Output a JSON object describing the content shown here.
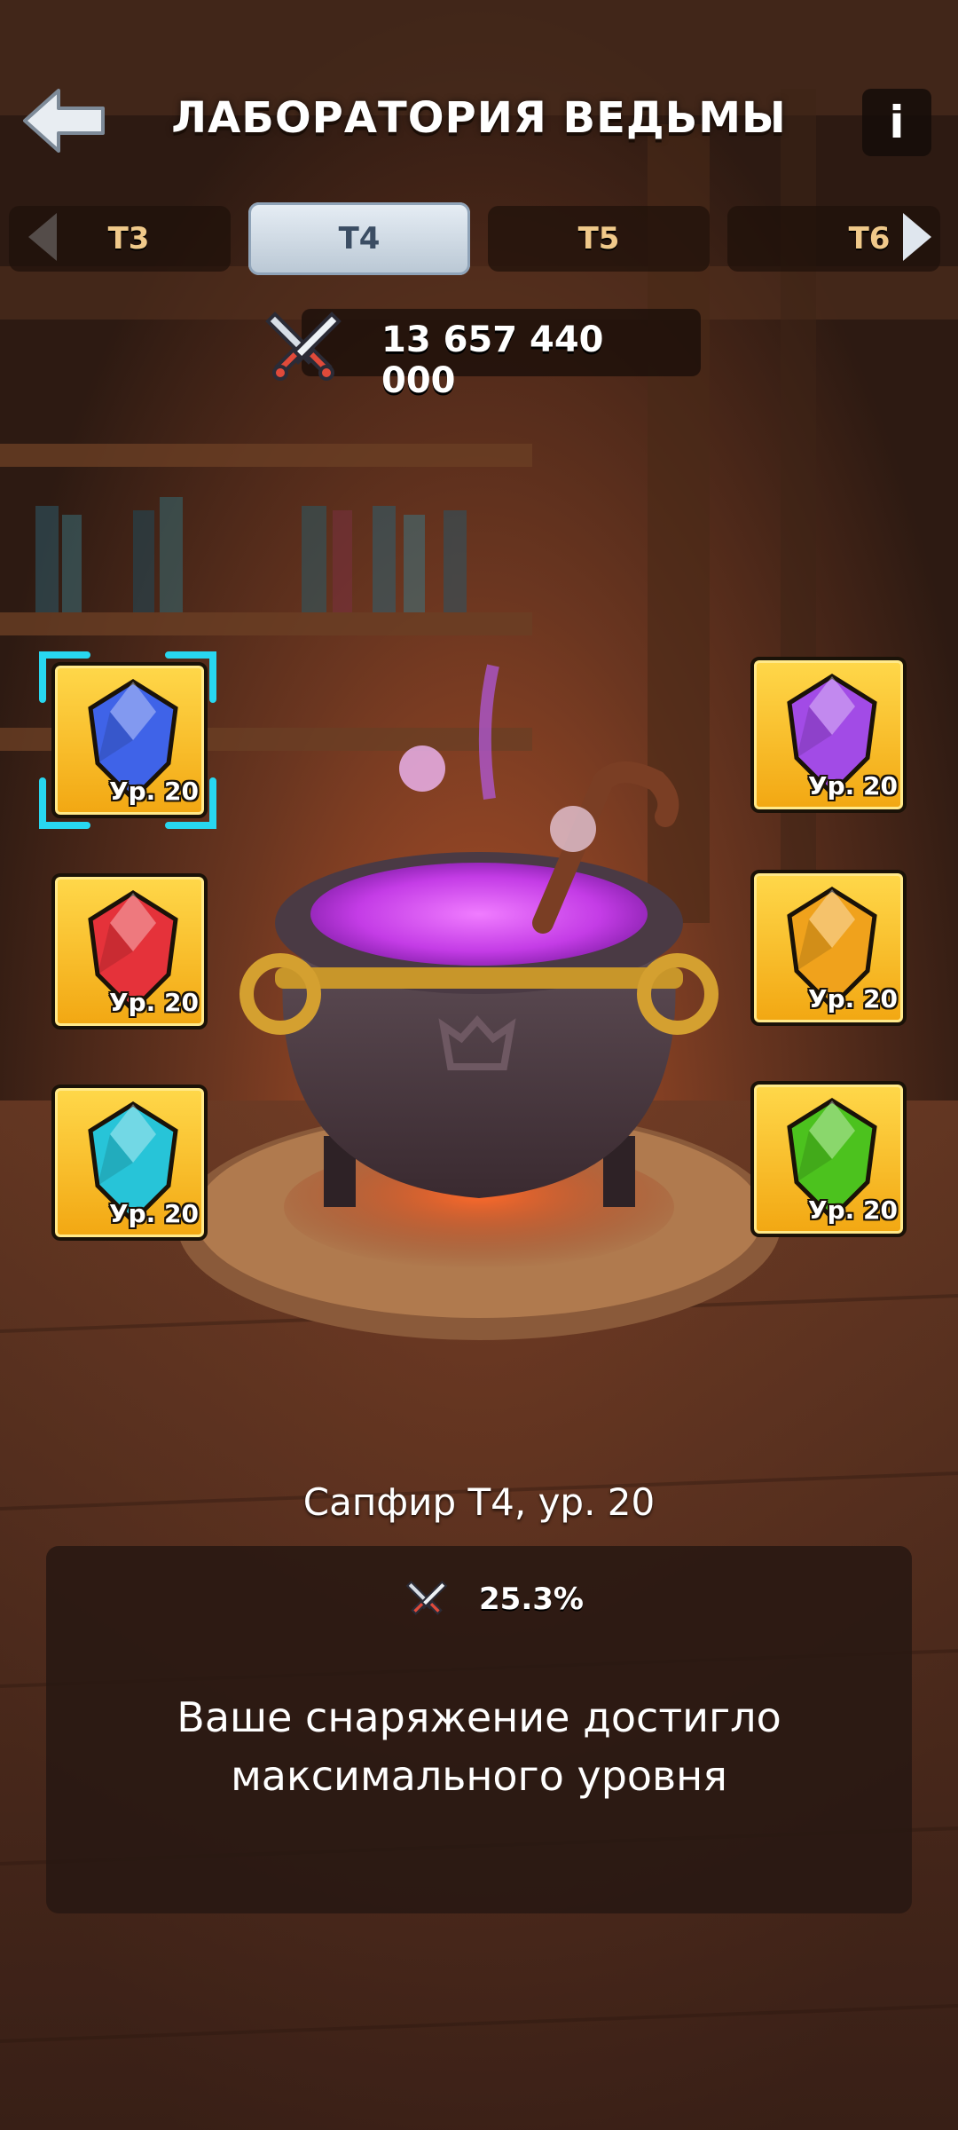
{
  "header": {
    "title": "ЛАБОРАТОРИЯ ВЕДЬМЫ",
    "back_icon": "back-arrow-icon",
    "info_label": "i"
  },
  "tiers": {
    "tabs": [
      {
        "label": "T3",
        "active": false
      },
      {
        "label": "T4",
        "active": true
      },
      {
        "label": "T5",
        "active": false
      },
      {
        "label": "T6",
        "active": false
      }
    ]
  },
  "power": {
    "icon": "crossed-swords-icon",
    "value": "13 657 440 000"
  },
  "gems": {
    "left": [
      {
        "name": "sapphire",
        "color": "#3f63e8",
        "level": "Ур. 20",
        "selected": true
      },
      {
        "name": "ruby",
        "color": "#e5323a",
        "level": "Ур. 20",
        "selected": false
      },
      {
        "name": "aquamarine",
        "color": "#27c4d8",
        "level": "Ур. 20",
        "selected": false
      }
    ],
    "right": [
      {
        "name": "amethyst",
        "color": "#a24be6",
        "level": "Ур. 20",
        "selected": false
      },
      {
        "name": "topaz",
        "color": "#f0a21c",
        "level": "Ур. 20",
        "selected": false
      },
      {
        "name": "emerald",
        "color": "#4cc21e",
        "level": "Ур. 20",
        "selected": false
      }
    ]
  },
  "item": {
    "name": "Сапфир T4, ур. 20",
    "bonus_icon": "crossed-swords-icon",
    "bonus_value": "25.3%",
    "message_line1": "Ваше снаряжение достигло",
    "message_line2": "максимального уровня"
  },
  "colors": {
    "potion": "#c43ce6",
    "slot_gold": "#f7c230",
    "selection": "#28d7f0"
  }
}
